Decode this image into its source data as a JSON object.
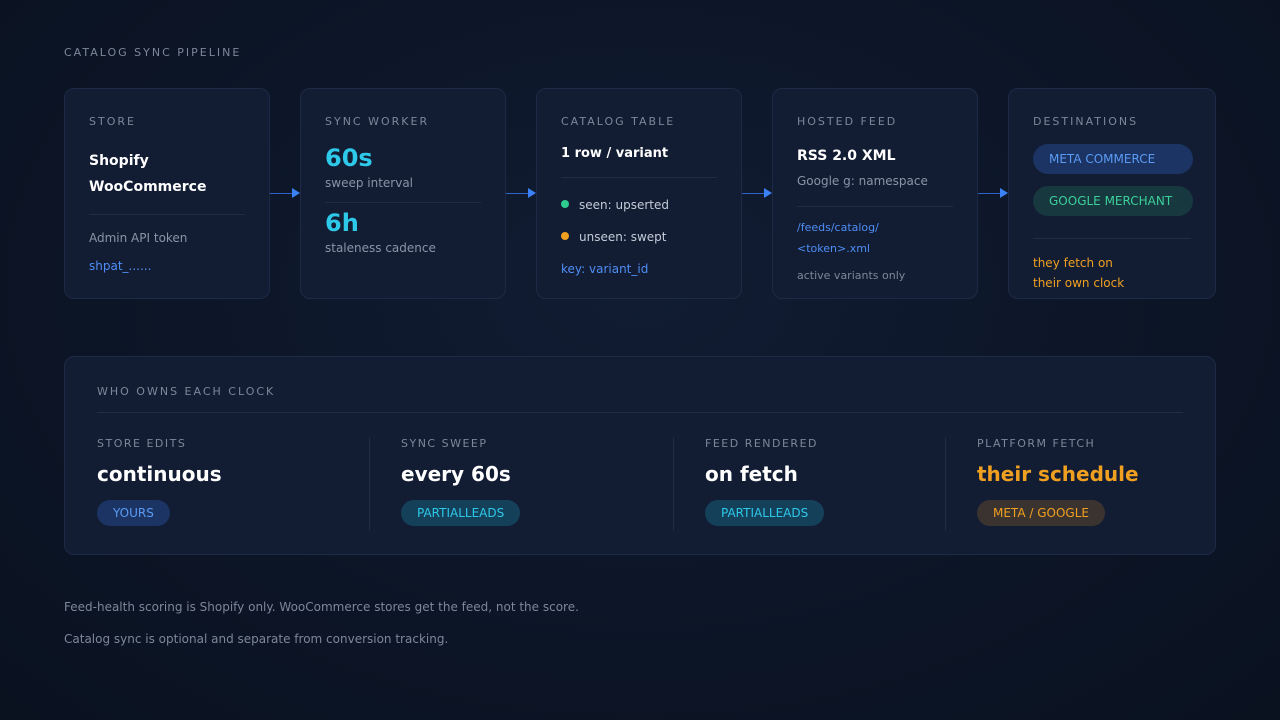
{
  "title": "CATALOG SYNC PIPELINE",
  "store": {
    "label": "STORE",
    "platforms": [
      "Shopify",
      "WooCommerce"
    ],
    "token_label": "Admin API token",
    "token_value": "shpat_......"
  },
  "sync_worker": {
    "label": "SYNC WORKER",
    "interval": "60s",
    "interval_caption": "sweep interval",
    "cadence": "6h",
    "cadence_caption": "staleness cadence"
  },
  "catalog_table": {
    "label": "CATALOG TABLE",
    "grain": "1 row / variant",
    "seen": "seen: upserted",
    "unseen": "unseen: swept",
    "key": "key: variant_id",
    "seen_color": "#2ecc8f",
    "unseen_color": "#f0a020"
  },
  "hosted_feed": {
    "label": "HOSTED FEED",
    "format": "RSS 2.0 XML",
    "namespace": "Google g: namespace",
    "path_line1": "/feeds/catalog/",
    "path_line2": "<token>.xml",
    "note": "active variants only"
  },
  "destinations": {
    "label": "DESTINATIONS",
    "items": [
      "META COMMERCE",
      "GOOGLE MERCHANT"
    ],
    "note_line1": "they fetch on",
    "note_line2": "their own clock"
  },
  "owners": {
    "label": "WHO OWNS EACH CLOCK",
    "columns": [
      {
        "label": "STORE EDITS",
        "value": "continuous",
        "badge": "YOURS"
      },
      {
        "label": "SYNC SWEEP",
        "value": "every 60s",
        "badge": "PARTIALLEADS"
      },
      {
        "label": "FEED RENDERED",
        "value": "on fetch",
        "badge": "PARTIALLEADS"
      },
      {
        "label": "PLATFORM FETCH",
        "value": "their schedule",
        "badge": "META / GOOGLE"
      }
    ]
  },
  "footnotes": [
    "Feed-health scoring is Shopify only. WooCommerce stores get the feed, not the score.",
    "Catalog sync is optional and separate from conversion tracking."
  ],
  "colors": {
    "accent_blue": "#3b82f6",
    "accent_cyan": "#2ec8e8",
    "accent_orange": "#f0a020",
    "accent_green": "#3ccf9a"
  }
}
